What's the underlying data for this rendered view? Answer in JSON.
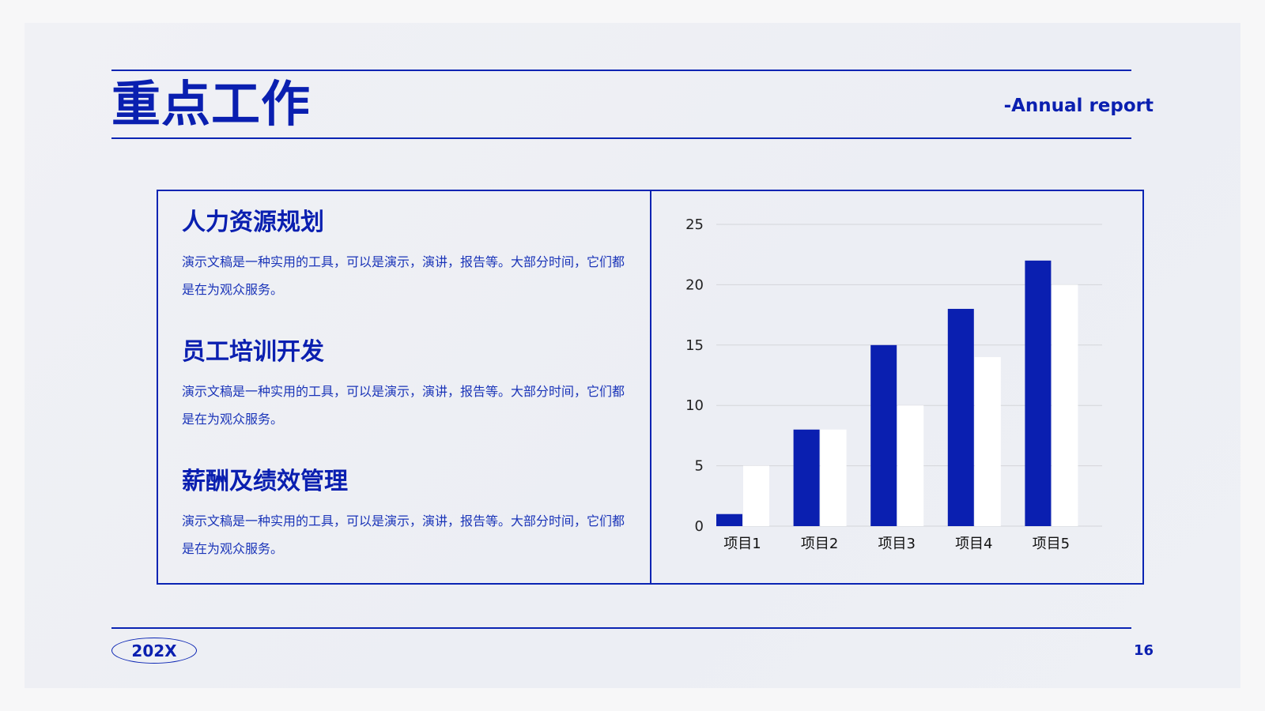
{
  "header": {
    "title": "重点工作",
    "subtitle": "-Annual report"
  },
  "sections": [
    {
      "heading": "人力资源规划",
      "body": "演示文稿是一种实用的工具，可以是演示，演讲，报告等。大部分时间，它们都是在为观众服务。"
    },
    {
      "heading": "员工培训开发",
      "body": "演示文稿是一种实用的工具，可以是演示，演讲，报告等。大部分时间，它们都是在为观众服务。"
    },
    {
      "heading": "薪酬及绩效管理",
      "body": "演示文稿是一种实用的工具，可以是演示，演讲，报告等。大部分时间，它们都是在为观众服务。"
    }
  ],
  "chart_data": {
    "type": "bar",
    "categories": [
      "项目1",
      "项目2",
      "项目3",
      "项目4",
      "项目5"
    ],
    "series": [
      {
        "values": [
          1,
          8,
          15,
          18,
          22
        ],
        "color": "#0a1fb0"
      },
      {
        "values": [
          5,
          8,
          10,
          14,
          20
        ],
        "color": "#ffffff"
      }
    ],
    "yticks": [
      0,
      5,
      10,
      15,
      20,
      25
    ],
    "ylim": [
      0,
      25
    ],
    "grid": true
  },
  "footer": {
    "logo_text": "202X",
    "page_number": "16"
  },
  "colors": {
    "accent": "#0a1fb0",
    "grid": "#d4d5da",
    "background": "#eef0f4"
  }
}
